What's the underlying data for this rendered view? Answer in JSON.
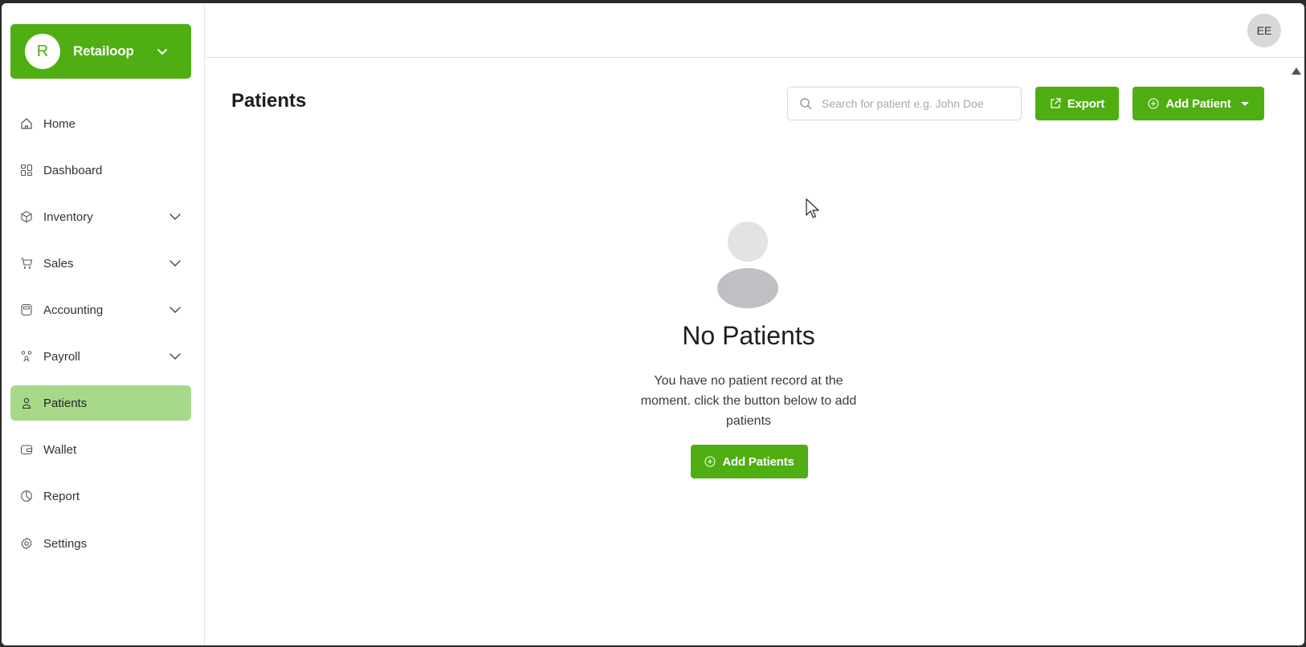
{
  "org": {
    "initial": "R",
    "name": "Retailoop"
  },
  "nav": [
    {
      "label": "Home",
      "icon": "home-icon",
      "expandable": false,
      "active": false
    },
    {
      "label": "Dashboard",
      "icon": "dashboard-icon",
      "expandable": false,
      "active": false
    },
    {
      "label": "Inventory",
      "icon": "box-icon",
      "expandable": true,
      "active": false
    },
    {
      "label": "Sales",
      "icon": "cart-icon",
      "expandable": true,
      "active": false
    },
    {
      "label": "Accounting",
      "icon": "calculator-icon",
      "expandable": true,
      "active": false
    },
    {
      "label": "Payroll",
      "icon": "people-icon",
      "expandable": true,
      "active": false
    },
    {
      "label": "Patients",
      "icon": "user-icon",
      "expandable": false,
      "active": true
    },
    {
      "label": "Wallet",
      "icon": "wallet-icon",
      "expandable": false,
      "active": false
    },
    {
      "label": "Report",
      "icon": "pie-chart-icon",
      "expandable": false,
      "active": false
    },
    {
      "label": "Settings",
      "icon": "gear-icon",
      "expandable": false,
      "active": false
    }
  ],
  "user": {
    "initials": "EE"
  },
  "page": {
    "title": "Patients",
    "search_placeholder": "Search for patient e.g. John Doe",
    "export_label": "Export",
    "add_label": "Add Patient"
  },
  "empty": {
    "title": "No Patients",
    "description": "You have no patient record at the moment. click the button below to add patients",
    "button_label": "Add Patients"
  },
  "colors": {
    "brand": "#4fae12",
    "active_nav": "#a8d98a"
  }
}
